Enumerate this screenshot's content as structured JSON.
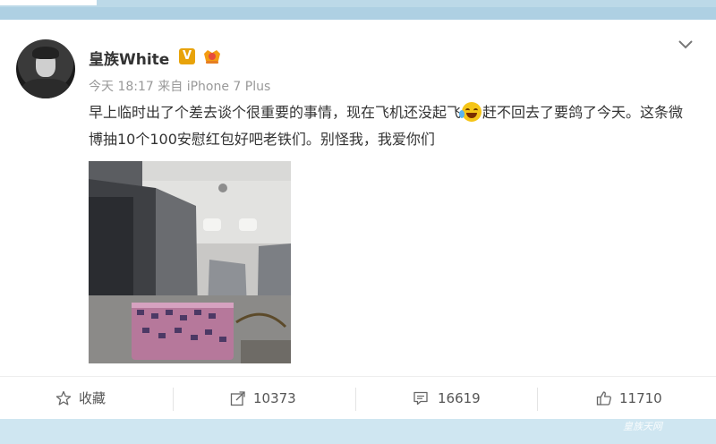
{
  "post": {
    "username": "皇族White",
    "verified_label": "V",
    "time": "今天 18:17",
    "source_prefix": "来自",
    "source_device": "iPhone 7 Plus",
    "text_part1": "早上临时出了个差去谈个很重要的事情，现在飞机还没起飞",
    "text_part2": "赶不回去了要鸽了今天。这条微博抽10个100安慰红包好吧老铁们。别怪我，我爱你们",
    "emoji_icon": "laugh-cry-emoji"
  },
  "actions": {
    "favorite_label": "收藏",
    "forward_count": "10373",
    "comment_count": "16619",
    "like_count": "11710"
  },
  "watermark": "皇族天网",
  "colors": {
    "band": "#bcd9e8",
    "verified": "#e8a30a",
    "meta_text": "#999999",
    "body_text": "#333333"
  }
}
